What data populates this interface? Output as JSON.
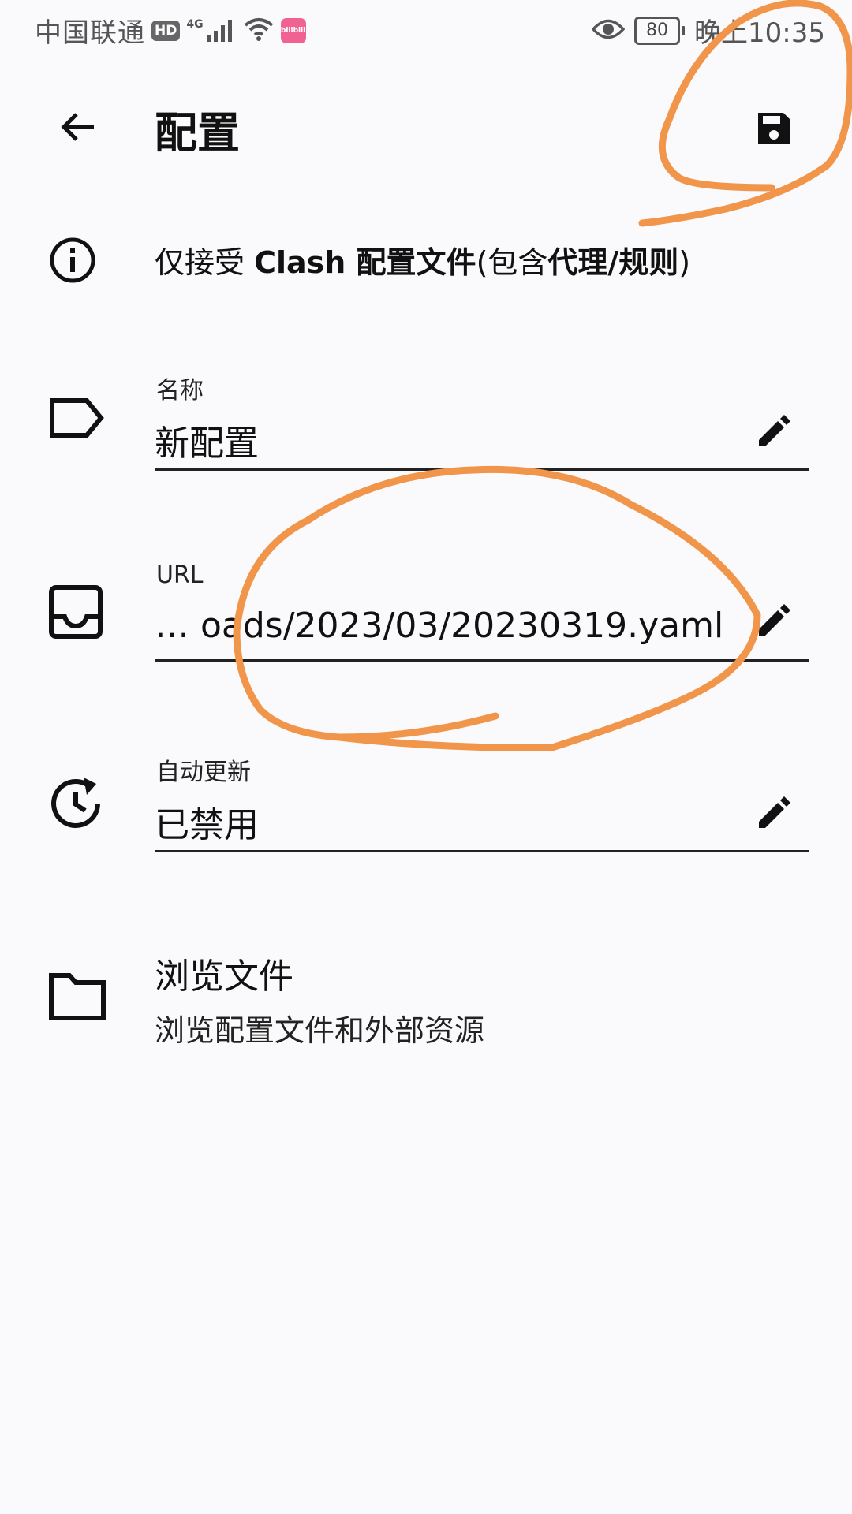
{
  "status_bar": {
    "carrier": "中国联通",
    "hd_badge": "HD",
    "network": "4G",
    "battery": "80",
    "time": "晚上10:35",
    "app_badge": "bilibili"
  },
  "header": {
    "title": "配置"
  },
  "notice": {
    "prefix": "仅接受 ",
    "clash": "Clash",
    "middle": " 配置文件",
    "paren_open": "(包含",
    "proxy_rules": "代理/规则",
    "paren_close": ")"
  },
  "fields": {
    "name": {
      "label": "名称",
      "value": "新配置"
    },
    "url": {
      "label": "URL",
      "value": "…    oads/2023/03/20230319.yaml"
    },
    "auto_update": {
      "label": "自动更新",
      "value": "已禁用"
    }
  },
  "browse": {
    "title": "浏览文件",
    "subtitle": "浏览配置文件和外部资源"
  },
  "colors": {
    "annotation": "#f0954a",
    "background": "#fafafc",
    "text": "#111111"
  },
  "icons": {
    "back": "arrow-left-icon",
    "save": "floppy-disk-icon",
    "info": "info-icon",
    "name": "label-tag-icon",
    "url": "inbox-tray-icon",
    "auto_update": "update-clock-icon",
    "edit": "pencil-icon",
    "browse": "folder-icon"
  }
}
